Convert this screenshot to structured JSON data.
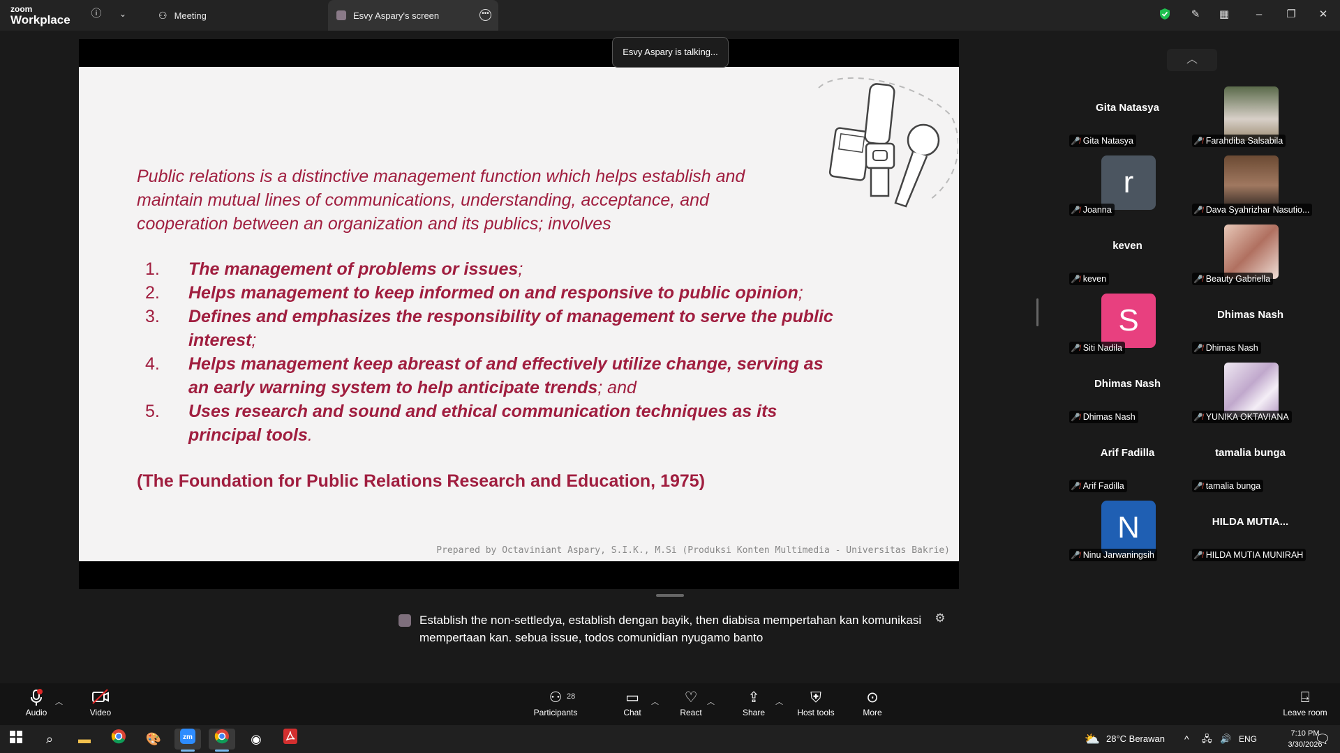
{
  "app": {
    "brand_top": "zoom",
    "brand_bottom": "Workplace"
  },
  "tabs": {
    "meeting": "Meeting",
    "screen": "Esvy Aspary's screen"
  },
  "talking": "Esvy Aspary is talking...",
  "slide": {
    "intro": "Public relations is a distinctive management function which helps establish and maintain mutual lines of communications, understanding, acceptance, and cooperation between an organization and its publics; involves",
    "items": [
      {
        "num": "1.",
        "bold": "The management of problems or issues",
        "tail": ";"
      },
      {
        "num": "2.",
        "bold": "Helps management to keep informed on and responsive to public opinion",
        "tail": ";"
      },
      {
        "num": "3.",
        "bold": "Defines and emphasizes the responsibility of management to serve the public interest",
        "tail": ";"
      },
      {
        "num": "4.",
        "bold": "Helps management keep abreast of and effectively utilize change, serving as an early warning system to help anticipate trends",
        "tail": "; and"
      },
      {
        "num": "5.",
        "bold": "Uses research and sound and ethical communication techniques as its principal tools",
        "tail": "."
      }
    ],
    "reference": "(The Foundation for Public Relations Research and Education, 1975)",
    "footer": "Prepared by Octaviniant Aspary, S.I.K., M.Si (Produksi Konten Multimedia - Universitas Bakrie)"
  },
  "gallery": [
    {
      "tile_name": "Gita Natasya",
      "label": "Gita Natasya",
      "kind": "name"
    },
    {
      "tile_name": "",
      "label": "Farahdiba Salsabila",
      "kind": "photo",
      "color": "#8c7f6a"
    },
    {
      "tile_name": "r",
      "label": "Joanna",
      "kind": "letter",
      "color": "#4b5560"
    },
    {
      "tile_name": "",
      "label": "Dava Syahrizhar Nasutio...",
      "kind": "photo",
      "color": "#6b4a33"
    },
    {
      "tile_name": "keven",
      "label": "keven",
      "kind": "name"
    },
    {
      "tile_name": "",
      "label": "Beauty Gabriella",
      "kind": "photo",
      "color": "#c89888"
    },
    {
      "tile_name": "S",
      "label": "Siti Nadila",
      "kind": "letter",
      "color": "#e8407f"
    },
    {
      "tile_name": "Dhimas Nash",
      "label": "Dhimas Nash",
      "kind": "name"
    },
    {
      "tile_name": "Dhimas Nash",
      "label": "Dhimas Nash",
      "kind": "name"
    },
    {
      "tile_name": "",
      "label": "YUNIKA OKTAVIANA",
      "kind": "photo",
      "color": "#cfc3d8"
    },
    {
      "tile_name": "Arif Fadilla",
      "label": "Arif Fadilla",
      "kind": "name"
    },
    {
      "tile_name": "tamalia bunga",
      "label": "tamalia bunga",
      "kind": "name"
    },
    {
      "tile_name": "N",
      "label": "Ninu Jarwaningsih",
      "kind": "letter",
      "color": "#1f5fb3"
    },
    {
      "tile_name": "HILDA  MUTIA...",
      "label": "HILDA MUTIA MUNIRAH",
      "kind": "name"
    }
  ],
  "caption": "Establish the non-settledya, establish dengan bayik, then diabisa mempertahan kan komunikasi mempertaan kan. sebua issue, todos comunidian nyugamo banto",
  "toolbar": {
    "audio": "Audio",
    "video": "Video",
    "participants": "Participants",
    "participants_count": "28",
    "chat": "Chat",
    "react": "React",
    "share": "Share",
    "host_tools": "Host tools",
    "more": "More",
    "leave": "Leave room"
  },
  "taskbar": {
    "weather": "28°C  Berawan",
    "lang": "ENG",
    "time": "7:10 PM",
    "date": "3/30/2026"
  },
  "colors": {
    "accent_red": "#a01e3f",
    "title_bar": "#232323"
  }
}
